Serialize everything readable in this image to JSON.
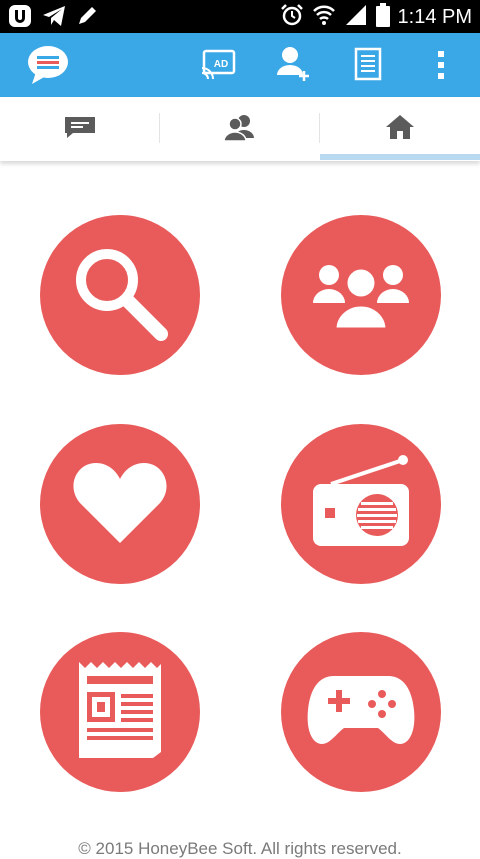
{
  "status_bar": {
    "time": "1:14 PM",
    "left_icons": [
      "u-app-icon",
      "telegram-icon",
      "pencil-icon"
    ],
    "right_icons": [
      "alarm-icon",
      "wifi-icon",
      "signal-icon",
      "battery-icon"
    ]
  },
  "app_bar": {
    "logo_icon": "chat-bubble-icon",
    "actions": [
      "ad-cast-icon",
      "add-user-icon",
      "document-icon",
      "more-vert-icon"
    ]
  },
  "tabs": [
    {
      "icon": "message-icon",
      "selected": false
    },
    {
      "icon": "people-icon",
      "selected": false
    },
    {
      "icon": "home-icon",
      "selected": true
    }
  ],
  "tiles": [
    {
      "icon": "search-icon"
    },
    {
      "icon": "group-icon"
    },
    {
      "icon": "heart-icon"
    },
    {
      "icon": "radio-icon"
    },
    {
      "icon": "newspaper-icon"
    },
    {
      "icon": "gamepad-icon"
    }
  ],
  "colors": {
    "status_bar": "#000000",
    "app_bar": "#3aa7e6",
    "tile": "#e95b5a",
    "tab_indicator": "#b8d9ef",
    "tab_icon": "#5b5b5b"
  },
  "footer": {
    "text": "© 2015 HoneyBee Soft. All rights reserved."
  }
}
